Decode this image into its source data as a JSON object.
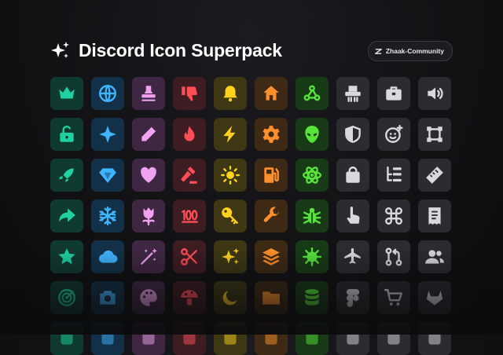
{
  "header": {
    "title": "Discord Icon Superpack",
    "badge_label": "Zhaak-Community"
  },
  "colors": {
    "background": "#121215",
    "teal": "#1fd1a0",
    "blue": "#3fb4ff",
    "pink": "#f0a2f0",
    "red": "#ff4d57",
    "yellow": "#ffd21c",
    "orange": "#ff8f2c",
    "green": "#56e43a",
    "gray": "#d8d8dd"
  },
  "icon_grid": {
    "rows": [
      [
        "crown-icon",
        "globe-icon",
        "stamp-icon",
        "thumbs-down-icon",
        "bell-icon",
        "home-icon",
        "webhook-icon",
        "shredder-icon",
        "toolbox-icon",
        "speaker-icon"
      ],
      [
        "unlock-icon",
        "sparkle-icon",
        "pencil-icon",
        "fire-icon",
        "lightning-icon",
        "gear-icon",
        "alien-icon",
        "shield-icon",
        "emoji-add-icon",
        "selection-icon"
      ],
      [
        "rocket-icon",
        "diamond-icon",
        "heart-icon",
        "gavel-icon",
        "sun-icon",
        "fuel-icon",
        "atom-icon",
        "bag-icon",
        "tree-list-icon",
        "ruler-icon"
      ],
      [
        "share-arrow-icon",
        "snowflake-icon",
        "tulip-icon",
        "hundred-icon",
        "key-icon",
        "wrench-icon",
        "bug-icon",
        "pointer-hand-icon",
        "command-icon",
        "receipt-icon"
      ],
      [
        "star-badge-icon",
        "cloud-icon",
        "magic-wand-icon",
        "scissors-icon",
        "sparkles-icon",
        "layers-icon",
        "virus-icon",
        "airplane-icon",
        "pull-request-icon",
        "users-icon"
      ],
      [
        "target-icon",
        "camera-icon",
        "palette-icon",
        "mushroom-icon",
        "moon-icon",
        "folder-icon",
        "database-icon",
        "figma-icon",
        "cart-icon",
        "gitlab-icon"
      ],
      [
        "row7-icon-1",
        "row7-icon-2",
        "row7-icon-3",
        "row7-icon-4",
        "row7-icon-5",
        "row7-icon-6",
        "row7-icon-7",
        "row7-icon-8",
        "row7-icon-9",
        "row7-icon-10"
      ]
    ],
    "column_colors": [
      "teal",
      "blue",
      "pink",
      "red",
      "yellow",
      "orange",
      "green",
      "gray",
      "gray",
      "gray"
    ]
  }
}
